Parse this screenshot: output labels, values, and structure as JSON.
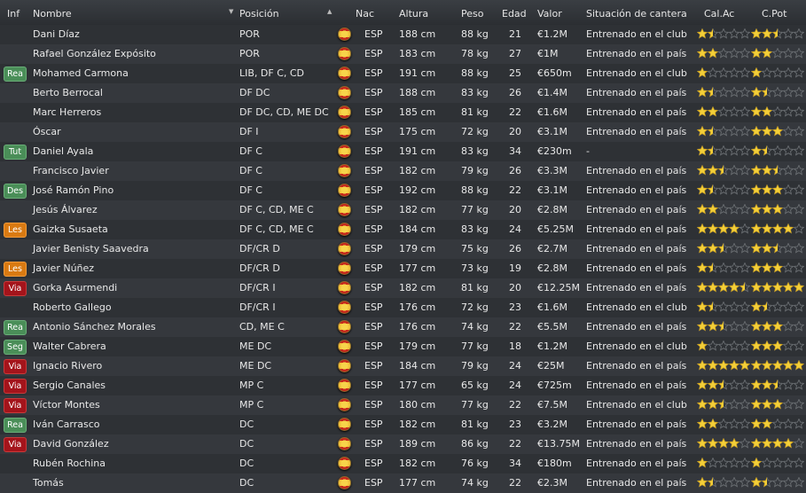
{
  "columns": {
    "inf": "Inf",
    "nombre": "Nombre",
    "posicion": "Posición",
    "nac": "Nac",
    "altura": "Altura",
    "peso": "Peso",
    "edad": "Edad",
    "valor": "Valor",
    "situacion": "Situación de cantera",
    "calac": "Cal.Ac",
    "cpot": "C.Pot"
  },
  "colors": {
    "green": "#4a8e58",
    "orange": "#d97a12",
    "red": "#a4141b",
    "star": "#f3cf3a"
  },
  "players": [
    {
      "inf": "",
      "badge": "",
      "name": "Dani Díaz",
      "pos": "POR",
      "nac": "ESP",
      "alt": "188 cm",
      "peso": "88 kg",
      "edad": "21",
      "valor": "€1.2M",
      "sit": "Entrenado en el club",
      "ca": 1.5,
      "cp": 2.5
    },
    {
      "inf": "",
      "badge": "",
      "name": "Rafael González Expósito",
      "pos": "POR",
      "nac": "ESP",
      "alt": "183 cm",
      "peso": "78 kg",
      "edad": "27",
      "valor": "€1M",
      "sit": "Entrenado en el país",
      "ca": 2,
      "cp": 2
    },
    {
      "inf": "Rea",
      "badge": "green",
      "name": "Mohamed Carmona",
      "pos": "LIB, DF C, CD",
      "nac": "ESP",
      "alt": "191 cm",
      "peso": "88 kg",
      "edad": "25",
      "valor": "€650m",
      "sit": "Entrenado en el club",
      "ca": 1,
      "cp": 1
    },
    {
      "inf": "",
      "badge": "",
      "name": "Berto Berrocal",
      "pos": "DF DC",
      "nac": "ESP",
      "alt": "188 cm",
      "peso": "83 kg",
      "edad": "26",
      "valor": "€1.4M",
      "sit": "Entrenado en el país",
      "ca": 1.5,
      "cp": 1.5
    },
    {
      "inf": "",
      "badge": "",
      "name": "Marc Herreros",
      "pos": "DF DC, CD, ME DC",
      "nac": "ESP",
      "alt": "185 cm",
      "peso": "81 kg",
      "edad": "22",
      "valor": "€1.6M",
      "sit": "Entrenado en el país",
      "ca": 2,
      "cp": 2
    },
    {
      "inf": "",
      "badge": "",
      "name": "Óscar",
      "pos": "DF I",
      "nac": "ESP",
      "alt": "175 cm",
      "peso": "72 kg",
      "edad": "20",
      "valor": "€3.1M",
      "sit": "Entrenado en el país",
      "ca": 1.5,
      "cp": 3
    },
    {
      "inf": "Tut",
      "badge": "green",
      "name": "Daniel Ayala",
      "pos": "DF C",
      "nac": "ESP",
      "alt": "191 cm",
      "peso": "83 kg",
      "edad": "34",
      "valor": "€230m",
      "sit": "-",
      "ca": 1.5,
      "cp": 1.5
    },
    {
      "inf": "",
      "badge": "",
      "name": "Francisco Javier",
      "pos": "DF C",
      "nac": "ESP",
      "alt": "182 cm",
      "peso": "79 kg",
      "edad": "26",
      "valor": "€3.3M",
      "sit": "Entrenado en el país",
      "ca": 2.5,
      "cp": 2.5
    },
    {
      "inf": "Des",
      "badge": "green",
      "name": "José Ramón Pino",
      "pos": "DF C",
      "nac": "ESP",
      "alt": "192 cm",
      "peso": "88 kg",
      "edad": "22",
      "valor": "€3.1M",
      "sit": "Entrenado en el país",
      "ca": 1.5,
      "cp": 3
    },
    {
      "inf": "",
      "badge": "",
      "name": "Jesús Álvarez",
      "pos": "DF C, CD, ME C",
      "nac": "ESP",
      "alt": "182 cm",
      "peso": "77 kg",
      "edad": "20",
      "valor": "€2.8M",
      "sit": "Entrenado en el país",
      "ca": 2,
      "cp": 3
    },
    {
      "inf": "Les",
      "badge": "orange",
      "name": "Gaizka Susaeta",
      "pos": "DF C, CD, ME C",
      "nac": "ESP",
      "alt": "184 cm",
      "peso": "83 kg",
      "edad": "24",
      "valor": "€5.25M",
      "sit": "Entrenado en el país",
      "ca": 4,
      "cp": 4
    },
    {
      "inf": "",
      "badge": "",
      "name": "Javier Benisty Saavedra",
      "pos": "DF/CR D",
      "nac": "ESP",
      "alt": "179 cm",
      "peso": "75 kg",
      "edad": "26",
      "valor": "€2.7M",
      "sit": "Entrenado en el país",
      "ca": 2.5,
      "cp": 2.5
    },
    {
      "inf": "Les",
      "badge": "orange",
      "name": "Javier Núñez",
      "pos": "DF/CR D",
      "nac": "ESP",
      "alt": "177 cm",
      "peso": "73 kg",
      "edad": "19",
      "valor": "€2.8M",
      "sit": "Entrenado en el país",
      "ca": 1.5,
      "cp": 3
    },
    {
      "inf": "Via",
      "badge": "red",
      "name": "Gorka Asurmendi",
      "pos": "DF/CR I",
      "nac": "ESP",
      "alt": "182 cm",
      "peso": "81 kg",
      "edad": "20",
      "valor": "€12.25M",
      "sit": "Entrenado en el país",
      "ca": 4.5,
      "cp": 5
    },
    {
      "inf": "",
      "badge": "",
      "name": "Roberto Gallego",
      "pos": "DF/CR I",
      "nac": "ESP",
      "alt": "176 cm",
      "peso": "72 kg",
      "edad": "23",
      "valor": "€1.6M",
      "sit": "Entrenado en el club",
      "ca": 1.5,
      "cp": 1.5
    },
    {
      "inf": "Rea",
      "badge": "green",
      "name": "Antonio Sánchez Morales",
      "pos": "CD, ME C",
      "nac": "ESP",
      "alt": "176 cm",
      "peso": "74 kg",
      "edad": "22",
      "valor": "€5.5M",
      "sit": "Entrenado en el país",
      "ca": 2.5,
      "cp": 3
    },
    {
      "inf": "Seg",
      "badge": "green",
      "name": "Walter Cabrera",
      "pos": "ME DC",
      "nac": "ESP",
      "alt": "179 cm",
      "peso": "77 kg",
      "edad": "18",
      "valor": "€1.2M",
      "sit": "Entrenado en el club",
      "ca": 1,
      "cp": 3
    },
    {
      "inf": "Via",
      "badge": "red",
      "name": "Ignacio Rivero",
      "pos": "ME DC",
      "nac": "ESP",
      "alt": "184 cm",
      "peso": "79 kg",
      "edad": "24",
      "valor": "€25M",
      "sit": "Entrenado en el país",
      "ca": 5,
      "cp": 5
    },
    {
      "inf": "Via",
      "badge": "red",
      "name": "Sergio Canales",
      "pos": "MP C",
      "nac": "ESP",
      "alt": "177 cm",
      "peso": "65 kg",
      "edad": "24",
      "valor": "€725m",
      "sit": "Entrenado en el país",
      "ca": 2.5,
      "cp": 2.5
    },
    {
      "inf": "Via",
      "badge": "red",
      "name": "Víctor Montes",
      "pos": "MP C",
      "nac": "ESP",
      "alt": "180 cm",
      "peso": "77 kg",
      "edad": "22",
      "valor": "€7.5M",
      "sit": "Entrenado en el club",
      "ca": 2.5,
      "cp": 3
    },
    {
      "inf": "Rea",
      "badge": "green",
      "name": "Iván Carrasco",
      "pos": "DC",
      "nac": "ESP",
      "alt": "182 cm",
      "peso": "81 kg",
      "edad": "23",
      "valor": "€3.2M",
      "sit": "Entrenado en el país",
      "ca": 2,
      "cp": 2
    },
    {
      "inf": "Via",
      "badge": "red",
      "name": "David González",
      "pos": "DC",
      "nac": "ESP",
      "alt": "189 cm",
      "peso": "86 kg",
      "edad": "22",
      "valor": "€13.75M",
      "sit": "Entrenado en el país",
      "ca": 4,
      "cp": 4
    },
    {
      "inf": "",
      "badge": "",
      "name": "Rubén Rochina",
      "pos": "DC",
      "nac": "ESP",
      "alt": "182 cm",
      "peso": "76 kg",
      "edad": "34",
      "valor": "€180m",
      "sit": "Entrenado en el país",
      "ca": 1,
      "cp": 1
    },
    {
      "inf": "",
      "badge": "",
      "name": "Tomás",
      "pos": "DC",
      "nac": "ESP",
      "alt": "177 cm",
      "peso": "74 kg",
      "edad": "22",
      "valor": "€2.3M",
      "sit": "Entrenado en el país",
      "ca": 1.5,
      "cp": 1.5
    }
  ]
}
